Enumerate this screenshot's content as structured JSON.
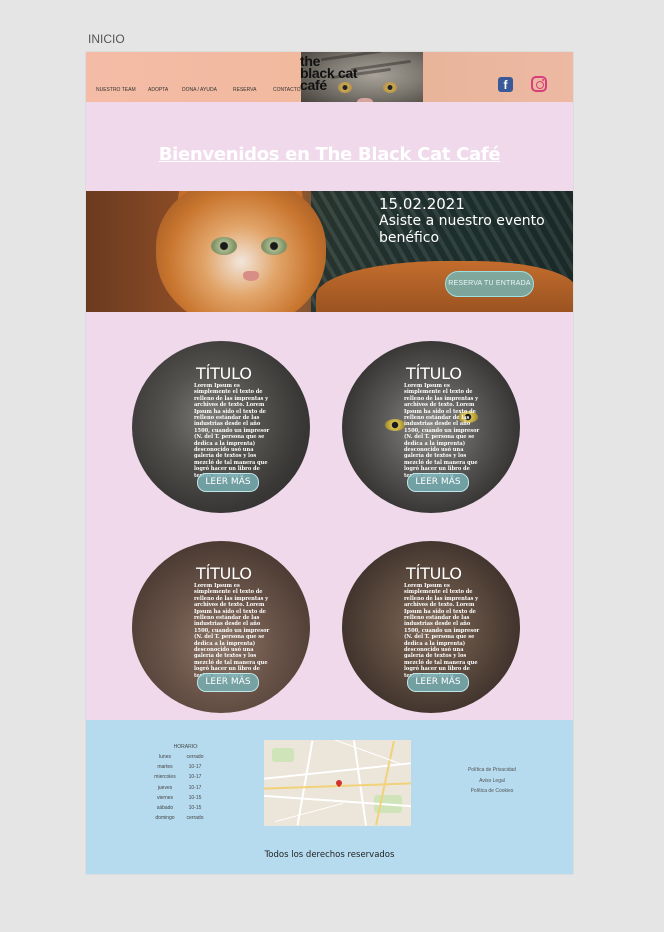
{
  "page_label": "INICIO",
  "header": {
    "logo_lines": [
      "the",
      "black cat",
      "café"
    ],
    "nav": [
      "NUESTRO TEAM",
      "ADOPTA",
      "DONA / AYUDA",
      "RESERVA",
      "CONTACTO"
    ],
    "social": [
      "facebook-icon",
      "instagram-icon"
    ]
  },
  "welcome": "Bienvenidos en The Black Cat Café",
  "banner": {
    "date": "15.02.2021",
    "text": "Asiste a nuestro evento benéfico",
    "button": "RESERVA TU ENTRADA"
  },
  "cards": [
    {
      "title": "TÍTULO",
      "body": "Lorem Ipsum es simplemente el texto de relleno de las imprentas y archivos de texto. Lorem Ipsum ha sido el texto de relleno estándar de las industrias desde el año 1500, cuando un impresor (N. del T. persona que se dedica a la imprenta) desconocido usó una galería de textos y los mezcló de tal manera que logró hacer un libro de textos especimen.",
      "button": "LEER MÁS"
    },
    {
      "title": "TÍTULO",
      "body": "Lorem Ipsum es simplemente el texto de relleno de las imprentas y archivos de texto. Lorem Ipsum ha sido el texto de relleno estándar de las industrias desde el año 1500, cuando un impresor (N. del T. persona que se dedica a la imprenta) desconocido usó una galería de textos y los mezcló de tal manera que logró hacer un libro de textos especimen.",
      "button": "LEER MÁS"
    },
    {
      "title": "TÍTULO",
      "body": "Lorem Ipsum es simplemente el texto de relleno de las imprentas y archivos de texto. Lorem Ipsum ha sido el texto de relleno estándar de las industrias desde el año 1500, cuando un impresor (N. del T. persona que se dedica a la imprenta) desconocido usó una galería de textos y los mezcló de tal manera que logró hacer un libro de textos especimen.",
      "button": "LEER MÁS"
    },
    {
      "title": "TÍTULO",
      "body": "Lorem Ipsum es simplemente el texto de relleno de las imprentas y archivos de texto. Lorem Ipsum ha sido el texto de relleno estándar de las industrias desde el año 1500, cuando un impresor (N. del T. persona que se dedica a la imprenta) desconocido usó una galería de textos y los mezcló de tal manera que logró hacer un libro de textos especimen.",
      "button": "LEER MÁS"
    }
  ],
  "footer": {
    "hours_title": "HORARIO:",
    "hours": [
      {
        "day": "lunes",
        "time": "cerrado"
      },
      {
        "day": "martes",
        "time": "10-17"
      },
      {
        "day": "miercoles",
        "time": "10-17"
      },
      {
        "day": "jueves",
        "time": "10-17"
      },
      {
        "day": "viernes",
        "time": "10-15"
      },
      {
        "day": "sábado",
        "time": "10-15"
      },
      {
        "day": "domingo",
        "time": "cerrado"
      }
    ],
    "legal": [
      "Política de Privacidad",
      "Aviso Legal",
      "Política de Cookies"
    ],
    "copyright": "Todos los derechos reservados"
  },
  "colors": {
    "page_bg": "#efd9ea",
    "header_bg": "#f1b99e",
    "footer_bg": "#b6dbef",
    "button_teal": "#78afb4"
  }
}
